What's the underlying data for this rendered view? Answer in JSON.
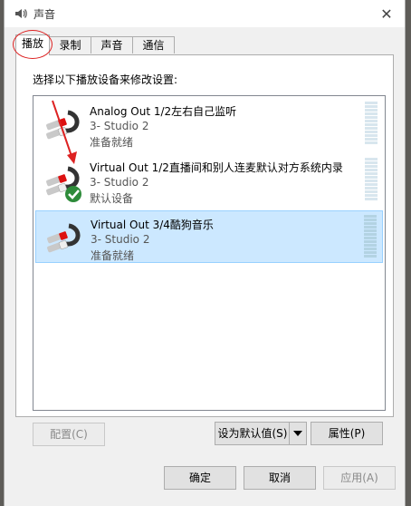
{
  "window": {
    "title": "声音",
    "close_glyph": "✕"
  },
  "tabs": [
    {
      "label": "播放",
      "active": true
    },
    {
      "label": "录制",
      "active": false
    },
    {
      "label": "声音",
      "active": false
    },
    {
      "label": "通信",
      "active": false
    }
  ],
  "instruction": "选择以下播放设备来修改设置:",
  "devices": [
    {
      "name": "Analog Out 1/2左右自己监听",
      "sub": "3- Studio 2",
      "status": "准备就绪",
      "default": false,
      "selected": false
    },
    {
      "name": "Virtual Out 1/2直播间和别人连麦默认对方系统内录",
      "sub": "3- Studio 2",
      "status": "默认设备",
      "default": true,
      "selected": false
    },
    {
      "name": "Virtual Out 3/4酷狗音乐",
      "sub": "3- Studio 2",
      "status": "准备就绪",
      "default": false,
      "selected": true
    }
  ],
  "buttons": {
    "configure": "配置(C)",
    "set_default": "设为默认值(S)",
    "properties": "属性(P)",
    "ok": "确定",
    "cancel": "取消",
    "apply": "应用(A)"
  },
  "colors": {
    "selection": "#cce8ff",
    "annotation": "#dd2222",
    "default_check": "#2e8b3a"
  }
}
